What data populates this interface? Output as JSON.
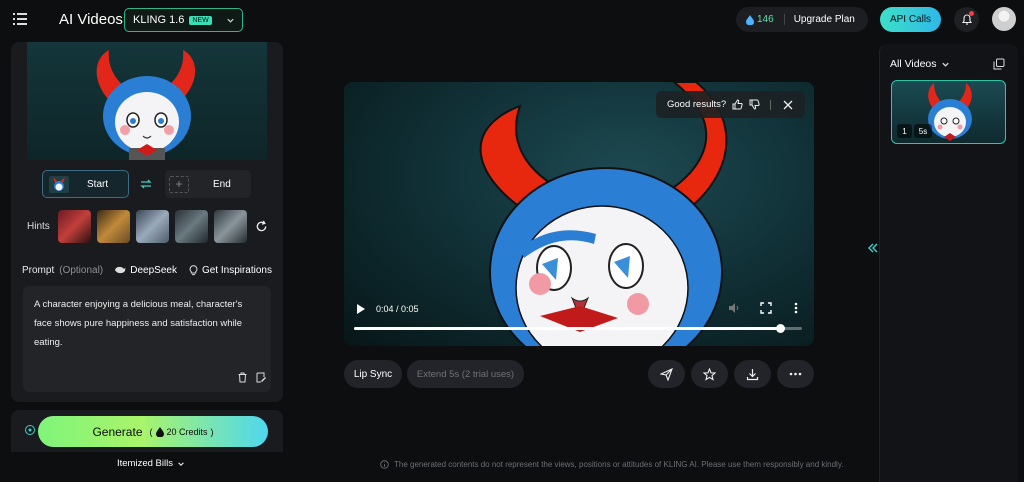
{
  "header": {
    "app_title": "AI Videos",
    "model": "KLING 1.6",
    "model_badge": "NEW",
    "credits": "146",
    "upgrade_label": "Upgrade Plan",
    "api_label": "API Calls"
  },
  "frames": {
    "start_label": "Start",
    "end_label": "End"
  },
  "hints": {
    "label": "Hints",
    "thumb_colors": [
      "#c2403a",
      "#c28a3a",
      "#7a8da0",
      "#5a6a70",
      "#6c7a82"
    ]
  },
  "prompt": {
    "label": "Prompt",
    "optional": "(Optional)",
    "deepseek": "DeepSeek",
    "inspirations": "Get Inspirations",
    "text": "A character enjoying a delicious meal, character's face shows pure happiness and satisfaction while eating."
  },
  "generate": {
    "label": "Generate",
    "credits": "20 Credits",
    "itemized": "Itemized Bills"
  },
  "video": {
    "feedback_prompt": "Good results?",
    "time": "0:04 / 0:05",
    "progress": 0.95
  },
  "actions": {
    "lip_sync": "Lip Sync",
    "extend": "Extend 5s (2 trial uses)"
  },
  "sidebar": {
    "title": "All Videos",
    "count": "1",
    "duration": "5s"
  },
  "footer": {
    "disclaimer": "The generated contents do not represent the views, positions or attitudes of KLING AI. Please use them responsibly and kindly."
  },
  "colors": {
    "accent": "#2fc6a7",
    "background": "#0d0e10",
    "character_horn": "#e82a14",
    "character_hood": "#2a7fd4"
  }
}
